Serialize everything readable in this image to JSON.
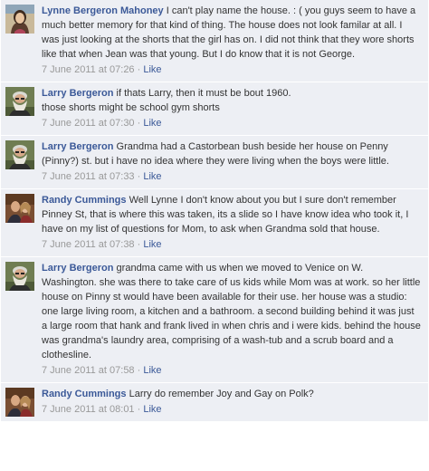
{
  "comments": [
    {
      "author": "Lynne Bergeron Mahoney",
      "text": "I can't play name the house. : ( you guys seem to have a much better memory for that kind of thing. The house does not look familar at all. I was just looking at the shorts that the girl has on. I did not think that they wore shorts like that when Jean was that young. But I do know that it is not George.",
      "timestamp": "7 June 2011 at 07:26",
      "separator": "·",
      "like_label": "Like",
      "avatar_icon": "avatar-female-woman-icon"
    },
    {
      "author": "Larry Bergeron",
      "text": "if thats Larry, then it must be bout 1960.\nthose shorts might be school gym shorts",
      "timestamp": "7 June 2011 at 07:30",
      "separator": "·",
      "like_label": "Like",
      "avatar_icon": "avatar-bearded-man-icon"
    },
    {
      "author": "Larry Bergeron",
      "text": "Grandma had a Castorbean bush beside her house on Penny (Pinny?) st. but i have no idea where they were living when the boys were little.",
      "timestamp": "7 June 2011 at 07:33",
      "separator": "·",
      "like_label": "Like",
      "avatar_icon": "avatar-bearded-man-icon"
    },
    {
      "author": "Randy Cummings",
      "text": "Well Lynne I don't know about you but I sure don't remember Pinney St, that is where this was taken, its a slide so I have know idea who took it, I have on my list of questions for Mom, to ask when Grandma sold that house.",
      "timestamp": "7 June 2011 at 07:38",
      "separator": "·",
      "like_label": "Like",
      "avatar_icon": "avatar-couple-icon"
    },
    {
      "author": "Larry Bergeron",
      "text": "grandma came with us when we moved to Venice on W. Washington. she was there to take care of us kids while Mom was at work. so her little house on Pinny st would have been available for their use. her house was a studio: one large living room, a kitchen and a bathroom. a second building behind it was just a large room that hank and frank lived in when chris and i were kids. behind the house was grandma's laundry area, comprising of a wash-tub and a scrub board and a clothesline.",
      "timestamp": "7 June 2011 at 07:58",
      "separator": "·",
      "like_label": "Like",
      "avatar_icon": "avatar-bearded-man-icon"
    },
    {
      "author": "Randy Cummings",
      "text": "Larry do remember Joy and Gay on Polk?",
      "timestamp": "7 June 2011 at 08:01",
      "separator": "·",
      "like_label": "Like",
      "avatar_icon": "avatar-couple-icon"
    }
  ],
  "colors": {
    "comment_bg": "#edeff4",
    "link": "#3b5998",
    "meta": "#999999",
    "text": "#333333"
  }
}
